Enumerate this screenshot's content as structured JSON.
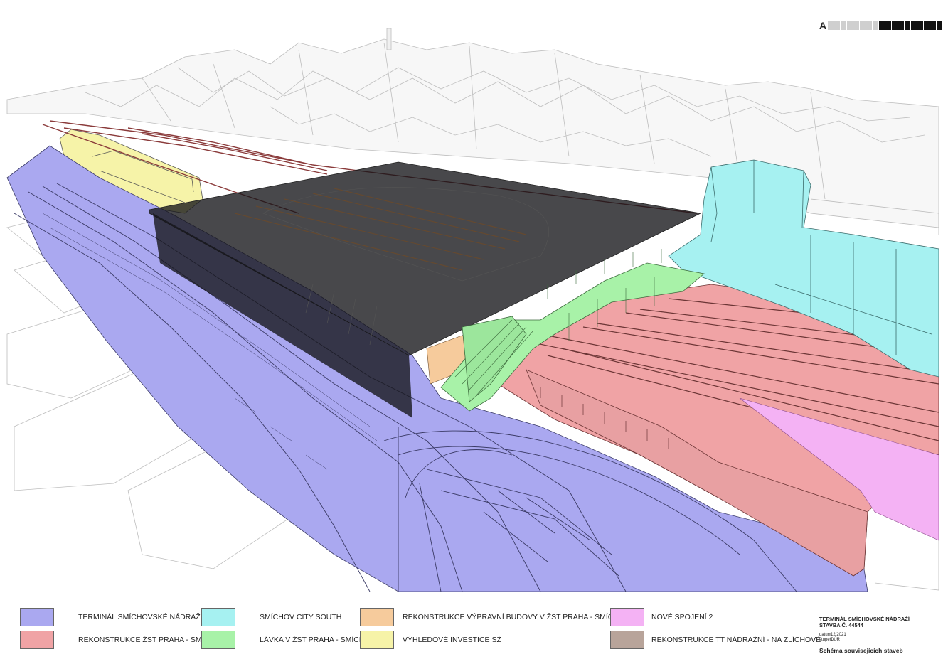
{
  "scale_bar": {
    "letter": "A",
    "cells": [
      "#cfcfcf",
      "#cfcfcf",
      "#cfcfcf",
      "#cfcfcf",
      "#cfcfcf",
      "#cfcfcf",
      "#cfcfcf",
      "#cfcfcf",
      "#111111",
      "#111111",
      "#111111",
      "#111111",
      "#111111",
      "#111111",
      "#111111",
      "#111111",
      "#111111",
      "#111111"
    ]
  },
  "legend": [
    {
      "label": "TERMINÁL SMÍCHOVSKÉ NÁDRAŽÍ",
      "color": "#aaa8f0"
    },
    {
      "label": "REKONSTRUKCE ŽST PRAHA - SMÍCHOV",
      "color": "#f0a3a5"
    },
    {
      "label": "SMÍCHOV CITY SOUTH",
      "color": "#a6f1f1"
    },
    {
      "label": "LÁVKA V ŽST PRAHA - SMÍCHOV",
      "color": "#a8f2a8"
    },
    {
      "label": "REKONSTRUKCE VÝPRAVNÍ BUDOVY V ŽST PRAHA - SMÍCHOV",
      "color": "#f6cb9c"
    },
    {
      "label": "VÝHLEDOVÉ INVESTICE SŽ",
      "color": "#f6f3a8"
    },
    {
      "label": "NOVÉ SPOJENÍ 2",
      "color": "#f4b2f4"
    },
    {
      "label": "REKONSTRUKCE TT NÁDRAŽNÍ - NA ZLÍCHOVĚ",
      "color": "#b8a49a"
    }
  ],
  "title_block": {
    "line1": "TERMINÁL SMÍCHOVSKÉ NÁDRAŽÍ",
    "line2": "STAVBA Č. 44544",
    "date_key": "datum",
    "date_value": "12/2021",
    "stage_key": "stupeň",
    "stage_value": "DÚR",
    "sheet_title": "Schéma souvisejících staveb"
  },
  "colors": {
    "terminal": "#aaa8f0",
    "rail": "#f0a3a5",
    "city_south": "#a6f1f1",
    "bridge": "#a8f2a8",
    "station_building": "#f6cb9c",
    "future_investment": "#f6f3a8",
    "new_connection": "#f4b2f4",
    "tram": "#8a3a3a",
    "roof_overlay": "#141418",
    "linework": "#3b3b66",
    "context_lines": "#b9b9b9"
  }
}
